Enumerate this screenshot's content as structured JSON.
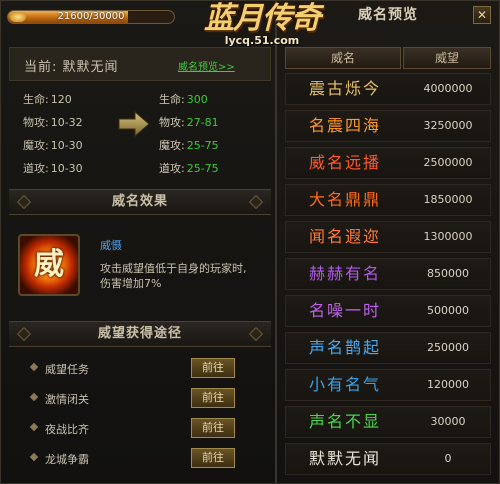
{
  "header": {
    "progress_text": "21600/30000",
    "progress_fraction": 0.72,
    "logo_title": "蓝月传奇",
    "logo_url": "lycq.51.com"
  },
  "current": {
    "label": "当前: 默默无闻",
    "preview_link": "威名预览>>"
  },
  "stats_before": [
    {
      "label": "生命:",
      "value": "120"
    },
    {
      "label": "物攻:",
      "value": "10-32"
    },
    {
      "label": "魔攻:",
      "value": "10-30"
    },
    {
      "label": "道攻:",
      "value": "10-30"
    }
  ],
  "stats_after": [
    {
      "label": "生命:",
      "value": "300"
    },
    {
      "label": "物攻:",
      "value": "27-81"
    },
    {
      "label": "魔攻:",
      "value": "25-75"
    },
    {
      "label": "道攻:",
      "value": "25-75"
    }
  ],
  "effect": {
    "section_title": "威名效果",
    "icon_char": "威",
    "name": "威慑",
    "description": "攻击威望值低于自身的玩家时, 伤害增加7%"
  },
  "ways": {
    "section_title": "威望获得途径",
    "go_label": "前往",
    "items": [
      "威望任务",
      "激情闭关",
      "夜战比齐",
      "龙城争霸"
    ]
  },
  "preview": {
    "title": "威名预览",
    "close_label": "✕",
    "col_name": "威名",
    "col_value": "威望",
    "rows": [
      {
        "name": "震古烁今",
        "value": "4000000",
        "color": "#e8c06a"
      },
      {
        "name": "名震四海",
        "value": "3250000",
        "color": "#ff9a2a"
      },
      {
        "name": "威名远播",
        "value": "2500000",
        "color": "#ff5a2a"
      },
      {
        "name": "大名鼎鼎",
        "value": "1850000",
        "color": "#ff6a1a"
      },
      {
        "name": "闻名遐迩",
        "value": "1300000",
        "color": "#ff7a3a"
      },
      {
        "name": "赫赫有名",
        "value": "850000",
        "color": "#b05ae8"
      },
      {
        "name": "名噪一时",
        "value": "500000",
        "color": "#c060f0"
      },
      {
        "name": "声名鹊起",
        "value": "250000",
        "color": "#4aa8f0"
      },
      {
        "name": "小有名气",
        "value": "120000",
        "color": "#3aa0e8"
      },
      {
        "name": "声名不显",
        "value": "30000",
        "color": "#4ad84a"
      },
      {
        "name": "默默无闻",
        "value": "0",
        "color": "#e8e4da"
      }
    ]
  }
}
